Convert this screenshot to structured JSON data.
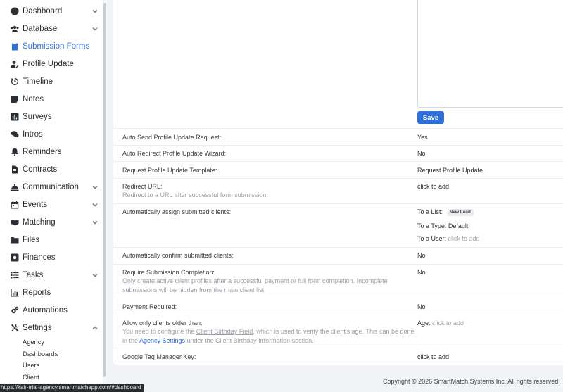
{
  "sidebar": {
    "items": [
      {
        "label": "Dashboard",
        "icon": "dashboard-icon",
        "chevron": true
      },
      {
        "label": "Database",
        "icon": "users-icon",
        "chevron": true
      },
      {
        "label": "Submission Forms",
        "icon": "clipboard-icon",
        "chevron": false,
        "active": true
      },
      {
        "label": "Profile Update",
        "icon": "user-edit-icon",
        "chevron": false
      },
      {
        "label": "Timeline",
        "icon": "history-icon",
        "chevron": false
      },
      {
        "label": "Notes",
        "icon": "note-icon",
        "chevron": false
      },
      {
        "label": "Surveys",
        "icon": "poll-icon",
        "chevron": false
      },
      {
        "label": "Intros",
        "icon": "comments-icon",
        "chevron": false
      },
      {
        "label": "Reminders",
        "icon": "bell-icon",
        "chevron": false
      },
      {
        "label": "Contracts",
        "icon": "file-contract-icon",
        "chevron": false
      },
      {
        "label": "Communication",
        "icon": "concierge-bell-icon",
        "chevron": true
      },
      {
        "label": "Events",
        "icon": "calendar-icon",
        "chevron": true
      },
      {
        "label": "Matching",
        "icon": "handshake-icon",
        "chevron": true
      },
      {
        "label": "Files",
        "icon": "folder-icon",
        "chevron": false
      },
      {
        "label": "Finances",
        "icon": "money-icon",
        "chevron": false
      },
      {
        "label": "Tasks",
        "icon": "tasks-icon",
        "chevron": true
      },
      {
        "label": "Reports",
        "icon": "chart-bar-icon",
        "chevron": false
      },
      {
        "label": "Automations",
        "icon": "cogs-icon",
        "chevron": false
      },
      {
        "label": "Settings",
        "icon": "tools-icon",
        "chevron": true,
        "expanded": true
      }
    ],
    "settings_sub": [
      "Agency",
      "Dashboards",
      "Users",
      "Client"
    ]
  },
  "main": {
    "save_label": "Save",
    "rows": {
      "auto_send": {
        "label": "Auto Send Profile Update Request:",
        "value": "Yes"
      },
      "auto_redirect": {
        "label": "Auto Redirect Profile Update Wizard:",
        "value": "No"
      },
      "template": {
        "label": "Request Profile Update Template:",
        "value": "Request Profile Update"
      },
      "redirect_url": {
        "label": "Redirect URL:",
        "desc": "Redirect to a URL after successful form submission",
        "value": "click to add"
      },
      "assign": {
        "label": "Automatically assign submitted clients:",
        "list_label": "To a List:",
        "list_badge": "New Lead",
        "type_label": "To a Type:",
        "type_value": "Default",
        "user_label": "To a User:",
        "user_value": "click to add"
      },
      "confirm": {
        "label": "Automatically confirm submitted clients:",
        "value": "No"
      },
      "require_completion": {
        "label": "Require Submission Completion:",
        "desc1": "Only create active client profiles after a successful payment or full form completion. Incomplete",
        "desc2": "submissions will be hidden from the main client list",
        "value": "No"
      },
      "payment": {
        "label": "Payment Required:",
        "value": "No"
      },
      "age": {
        "label": "Allow only clients older than:",
        "desc_a": "You need to configure the ",
        "desc_link1": "Client Birthday Field",
        "desc_b": ", which is used to verify the client's age. This can be done",
        "desc_c": "in the ",
        "desc_link2": "Agency Settings",
        "desc_d": " under the Client Birthday Information section.",
        "value_label": "Age:",
        "value": "click to add"
      },
      "gtm": {
        "label": "Google Tag Manager Key:",
        "value": "click to add"
      }
    }
  },
  "footer": {
    "text": "Copyright © 2026 SmartMatch Systems Inc. All rights reserved."
  },
  "status_url": "https://kair-trial-agency.smartmatchapp.com/#dashboard",
  "colors": {
    "accent": "#2e6fd8",
    "muted": "#9aa0a8"
  }
}
